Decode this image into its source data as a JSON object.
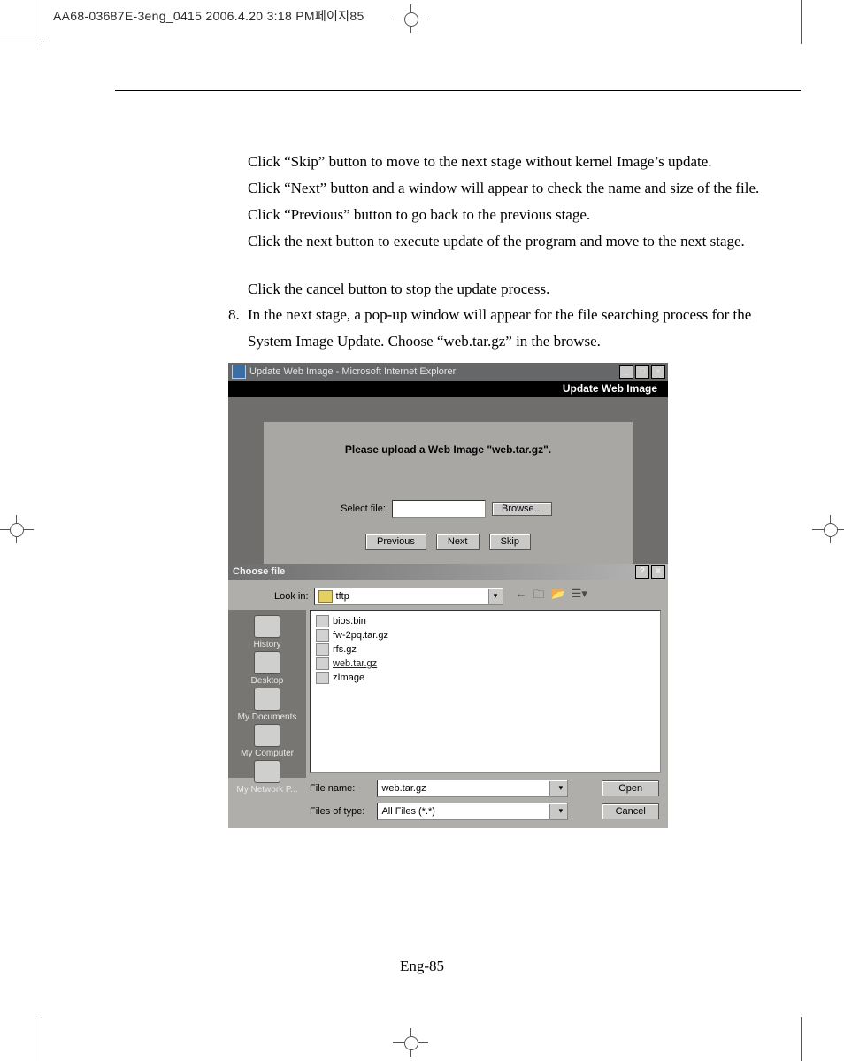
{
  "header_text": "AA68-03687E-3eng_0415  2006.4.20 3:18 PM페이지85",
  "instructions": {
    "p1": "Click “Skip” button to move to the next stage without kernel Image’s update.",
    "p2": "Click “Next” button and a window will appear to check the name and size of the file.",
    "p3": "Click “Previous” button to go back to the previous stage.",
    "p4": "Click the next button to execute update of the program and move to the next stage.",
    "p5": "Click the cancel button to stop the update process."
  },
  "step8": {
    "num": "8.",
    "line1": "In the next stage, a pop-up window will appear for the file searching process for the",
    "line2": "System Image Update. Choose “web.tar.gz” in the browse."
  },
  "ie": {
    "title": "Update Web Image - Microsoft Internet Explorer",
    "band": "Update Web Image",
    "prompt": "Please upload a Web Image \"web.tar.gz\".",
    "select_label": "Select file:",
    "browse": "Browse...",
    "previous": "Previous",
    "next": "Next",
    "skip": "Skip"
  },
  "dialog": {
    "title": "Choose file",
    "lookin_label": "Look in:",
    "lookin_value": "tftp",
    "places": {
      "history": "History",
      "desktop": "Desktop",
      "documents": "My Documents",
      "computer": "My Computer",
      "network": "My Network P..."
    },
    "files": {
      "f0": "bios.bin",
      "f1": "fw-2pq.tar.gz",
      "f2": "rfs.gz",
      "f3": "web.tar.gz",
      "f4": "zImage"
    },
    "filename_label": "File name:",
    "filename_value": "web.tar.gz",
    "filetype_label": "Files of type:",
    "filetype_value": "All Files (*.*)",
    "open": "Open",
    "cancel": "Cancel"
  },
  "page_number": "Eng-85"
}
